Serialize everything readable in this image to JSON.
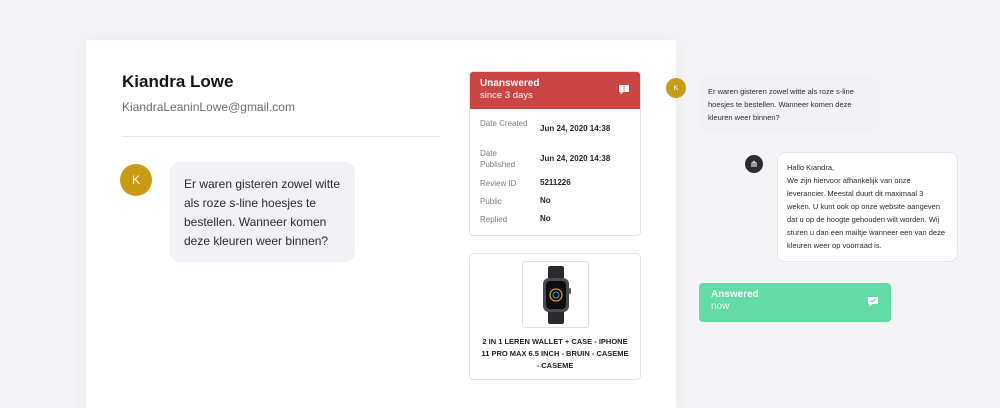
{
  "customer": {
    "name": "Kiandra Lowe",
    "email": "KiandraLeaninLowe@gmail.com",
    "avatar_initial": "K"
  },
  "review": {
    "message": "Er waren gisteren zowel witte als roze s-line hoesjes te bestellen. Wanneer komen deze kleuren weer binnen?"
  },
  "status": {
    "title": "Unanswered",
    "subtitle": "since 3 days",
    "color": "#cc4545",
    "icon": "chat-alert-icon",
    "rows": [
      {
        "label": "Date Created",
        "value": "Jun 24, 2020 14:38"
      },
      {
        "label": "Date Published",
        "value": "Jun 24, 2020 14:38"
      },
      {
        "label": "Review ID",
        "value": "5211226"
      },
      {
        "label": "Public",
        "value": "No"
      },
      {
        "label": "Replied",
        "value": "No"
      }
    ]
  },
  "product": {
    "image_icon": "smartwatch-icon",
    "title": "2 IN 1 LEREN WALLET + CASE - IPHONE 11 PRO MAX 6.5 INCH - BRUIN - CASEME - CASEME"
  },
  "conversation": {
    "customer_initial": "K",
    "question": "Er waren gisteren zowel witte als roze s-line hoesjes te bestellen. Wanneer komen deze kleuren weer binnen?",
    "shop_logo_icon": "shop-logo-icon",
    "reply": "Hallo Kiandra,\nWe zijn hiervoor afhankelijk van onze leverancier. Meestal duurt dit maximaal 3 weken. U kunt ook op onze website aangeven dat u op de hoogte gehouden wilt worden. Wij sturen u dan een mailtje wanneer een van deze kleuren weer op voorraad is."
  },
  "answered": {
    "title": "Answered",
    "subtitle": "now",
    "color": "#63dba6",
    "icon": "chat-check-icon"
  }
}
